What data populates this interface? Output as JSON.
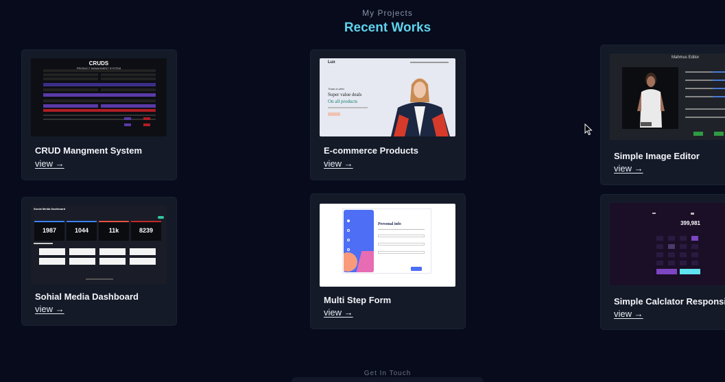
{
  "section": {
    "eyebrow": "My Projects",
    "title": "Recent Works"
  },
  "projects": [
    {
      "title": "CRUD Mangment System",
      "link": "view →",
      "thumb_header": "CRUDS",
      "thumb_sub": "PRODUCT MANAGMENT SYSTEM"
    },
    {
      "title": "E-commerce Products",
      "link": "view →",
      "thumb_logo": "Lux",
      "thumb_line1": "Trade-in-offer",
      "thumb_line2": "Super value deals",
      "thumb_line3": "On all products"
    },
    {
      "title": "Simple Image Editor",
      "link": "view →",
      "thumb_header": "Mahmus Editor"
    },
    {
      "title": "Sohial Media Dashboard",
      "link": "view →",
      "thumb_header": "Social Media Dashboard",
      "stats": [
        "1987",
        "1044",
        "11k",
        "8239"
      ]
    },
    {
      "title": "Multi Step Form",
      "link": "view →",
      "thumb_header": "Personal info"
    },
    {
      "title": "Simple Calclator Responsive",
      "link": "view →",
      "thumb_display": "399,981"
    }
  ],
  "footer": {
    "label": "Get In Touch"
  },
  "colors": {
    "background": "#070b1c",
    "card": "#141a27",
    "heading": "#5fd3ec"
  }
}
